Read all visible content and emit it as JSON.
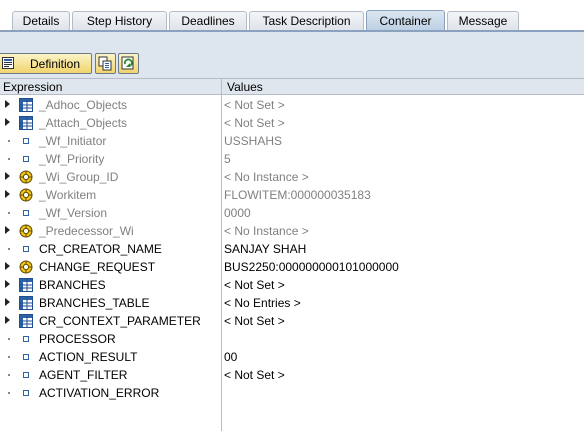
{
  "tabs": [
    {
      "label": "Details",
      "active": false
    },
    {
      "label": "Step History",
      "active": false
    },
    {
      "label": "Deadlines",
      "active": false
    },
    {
      "label": "Task Description",
      "active": false
    },
    {
      "label": "Container",
      "active": true
    },
    {
      "label": "Message",
      "active": false
    }
  ],
  "toolbar": {
    "definition_label": "Definition"
  },
  "table": {
    "headers": {
      "expression": "Expression",
      "values": "Values"
    },
    "rows": [
      {
        "name": "_Adhoc_Objects",
        "value": "< Not Set >",
        "icon": "table-icon",
        "expandable": true,
        "system": true
      },
      {
        "name": "_Attach_Objects",
        "value": "< Not Set >",
        "icon": "table-icon",
        "expandable": true,
        "system": true
      },
      {
        "name": "_Wf_Initiator",
        "value": "USSHAHS",
        "icon": "element-icon",
        "expandable": false,
        "system": true
      },
      {
        "name": "_Wf_Priority",
        "value": "5",
        "icon": "element-icon",
        "expandable": false,
        "system": true
      },
      {
        "name": "_Wi_Group_ID",
        "value": "< No Instance >",
        "icon": "object-icon",
        "expandable": true,
        "system": true
      },
      {
        "name": "_Workitem",
        "value": "FLOWITEM:000000035183",
        "icon": "object-icon",
        "expandable": true,
        "system": true
      },
      {
        "name": "_Wf_Version",
        "value": "0000",
        "icon": "element-icon",
        "expandable": false,
        "system": true
      },
      {
        "name": "_Predecessor_Wi",
        "value": "< No Instance >",
        "icon": "object-icon",
        "expandable": true,
        "system": true
      },
      {
        "name": "CR_CREATOR_NAME",
        "value": "SANJAY SHAH",
        "icon": "element-icon",
        "expandable": false,
        "system": false
      },
      {
        "name": "CHANGE_REQUEST",
        "value": "BUS2250:000000000101000000",
        "icon": "object-icon",
        "expandable": true,
        "system": false
      },
      {
        "name": "BRANCHES",
        "value": "< Not Set >",
        "icon": "table-icon",
        "expandable": true,
        "system": false
      },
      {
        "name": "BRANCHES_TABLE",
        "value": "< No Entries >",
        "icon": "table-icon",
        "expandable": true,
        "system": false
      },
      {
        "name": "CR_CONTEXT_PARAMETER",
        "value": "< Not Set >",
        "icon": "table-icon",
        "expandable": true,
        "system": false
      },
      {
        "name": "PROCESSOR",
        "value": "",
        "icon": "element-icon",
        "expandable": false,
        "system": false
      },
      {
        "name": "ACTION_RESULT",
        "value": "00",
        "icon": "element-icon",
        "expandable": false,
        "system": false
      },
      {
        "name": "AGENT_FILTER",
        "value": "< Not Set >",
        "icon": "element-icon",
        "expandable": false,
        "system": false
      },
      {
        "name": "ACTIVATION_ERROR",
        "value": "",
        "icon": "element-icon",
        "expandable": false,
        "system": false
      }
    ]
  }
}
